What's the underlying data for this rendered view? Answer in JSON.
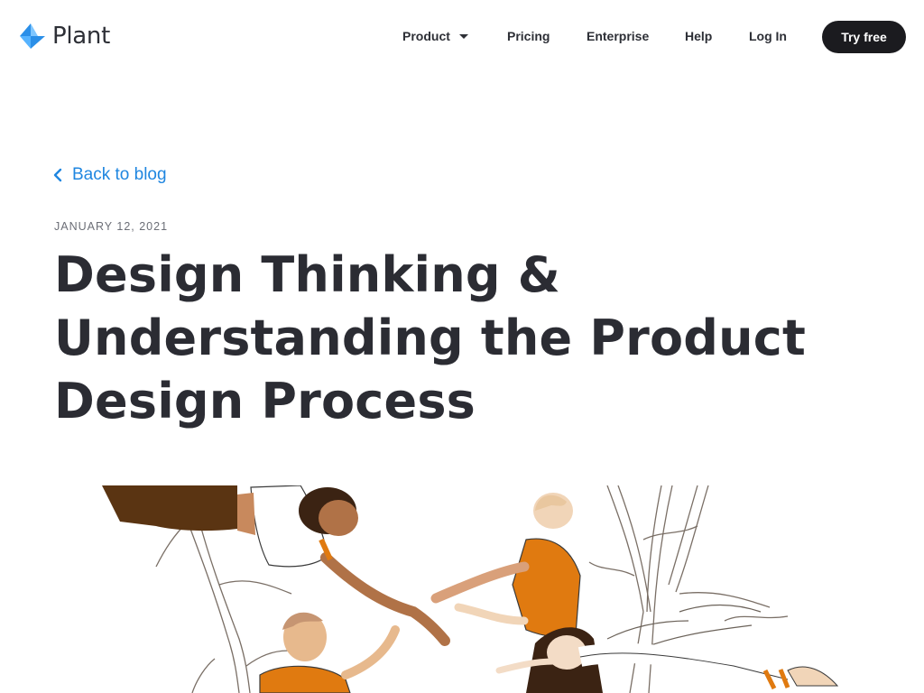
{
  "header": {
    "logo_text": "Plant",
    "nav": {
      "product": "Product",
      "pricing": "Pricing",
      "enterprise": "Enterprise",
      "help": "Help",
      "login": "Log In"
    },
    "cta_label": "Try free"
  },
  "article": {
    "back_label": "Back to blog",
    "date": "JANUARY 12, 2021",
    "title": "Design Thinking & Understanding the Product Design Process"
  },
  "colors": {
    "accent": "#1f86e0",
    "cta_bg": "#1b1b1f",
    "title": "#2b2c33",
    "illustration_orange": "#e07a10"
  },
  "icons": {
    "logo": "plant-logo-icon",
    "back": "chevron-left-icon",
    "dropdown": "caret-down-icon"
  }
}
